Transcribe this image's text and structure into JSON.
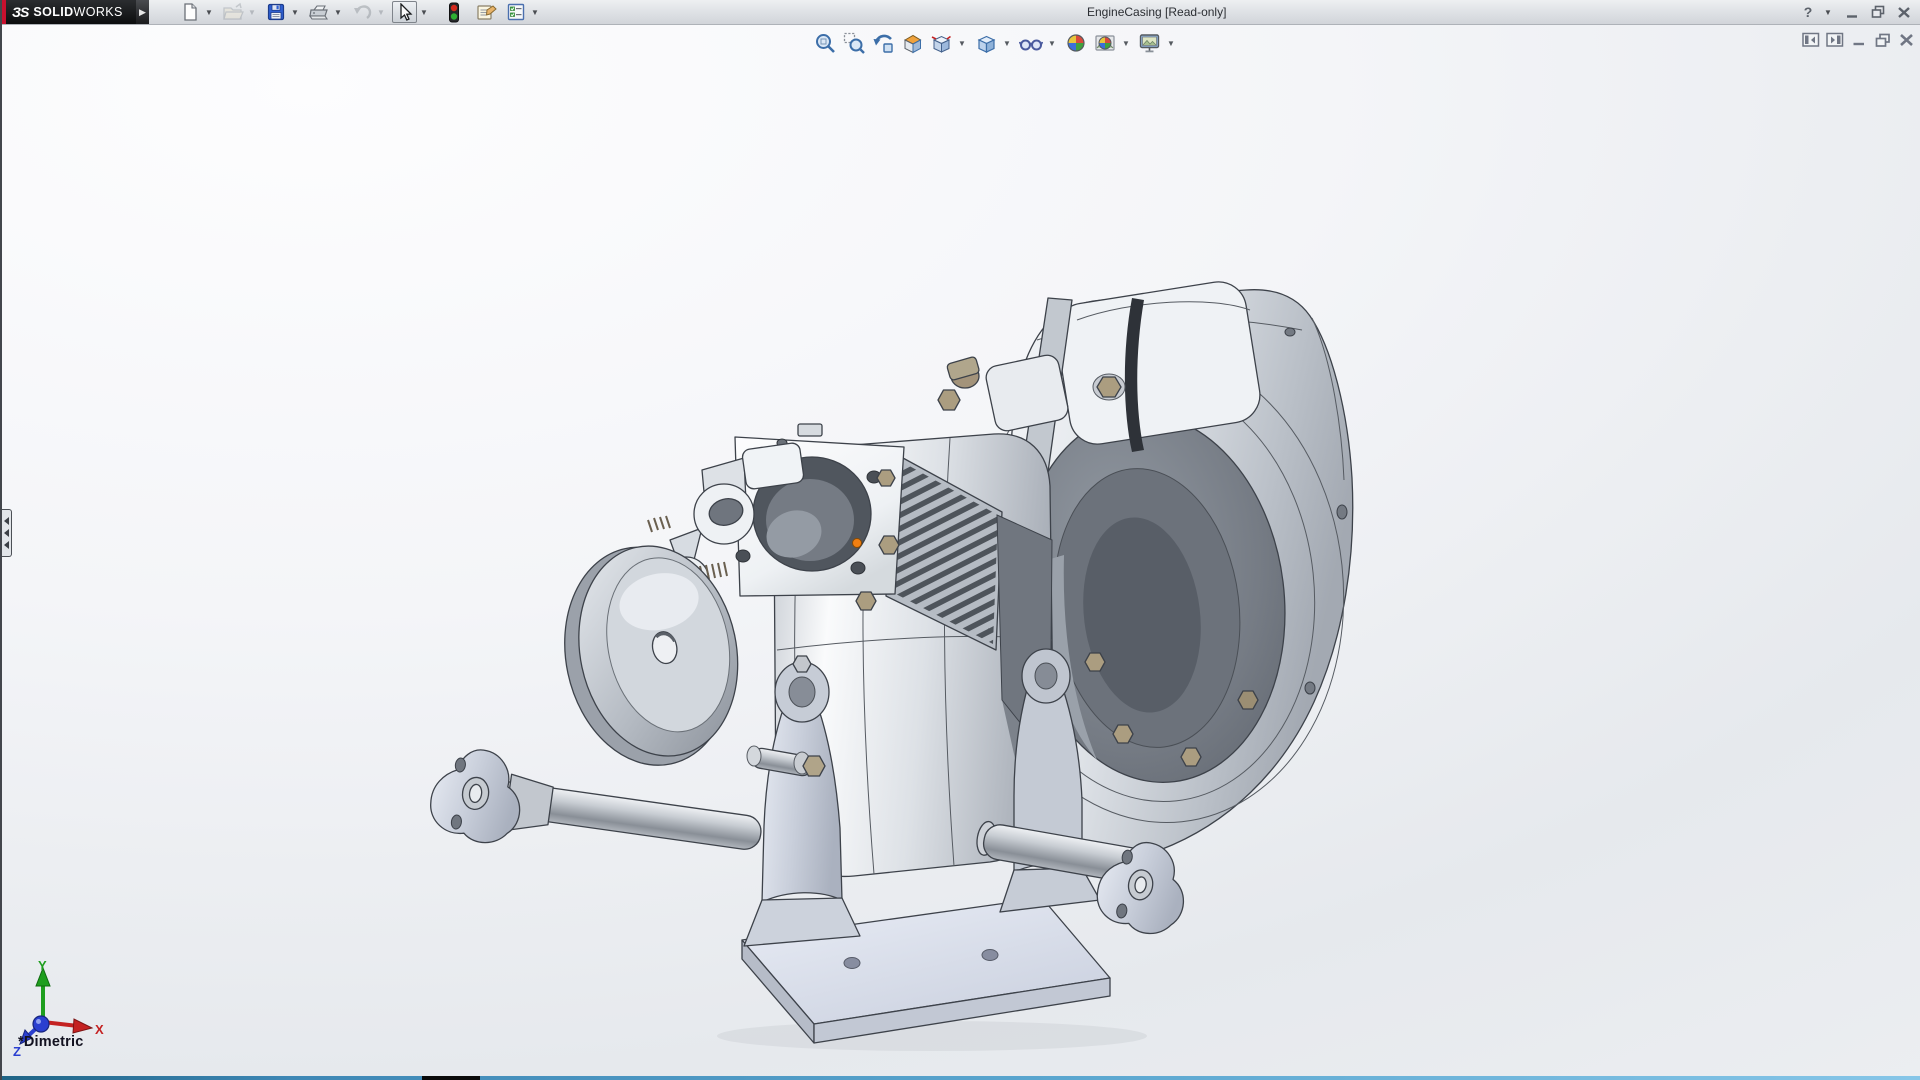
{
  "window": {
    "title": "EngineCasing [Read-only]",
    "logo": {
      "mark": "ЗS",
      "brand_bold": "SOLID",
      "brand_light": "WORKS"
    },
    "controls": {
      "help": "Help",
      "minimize": "Minimize",
      "restore": "Restore Down",
      "close": "Close"
    }
  },
  "toolbar": {
    "items": [
      {
        "name": "new",
        "tooltip": "New",
        "enabled": true,
        "dropdown": true
      },
      {
        "name": "open",
        "tooltip": "Open",
        "enabled": false,
        "dropdown": true
      },
      {
        "name": "save",
        "tooltip": "Save",
        "enabled": true,
        "dropdown": true
      },
      {
        "name": "print",
        "tooltip": "Print",
        "enabled": true,
        "dropdown": true
      },
      {
        "name": "undo",
        "tooltip": "Undo",
        "enabled": false,
        "dropdown": true
      },
      {
        "name": "select",
        "tooltip": "Select",
        "enabled": true,
        "dropdown": true,
        "active": true
      },
      {
        "name": "rebuild",
        "tooltip": "Rebuild",
        "enabled": true,
        "dropdown": false
      },
      {
        "name": "file-properties",
        "tooltip": "File Properties",
        "enabled": true,
        "dropdown": false
      },
      {
        "name": "options",
        "tooltip": "Options",
        "enabled": true,
        "dropdown": true
      }
    ]
  },
  "viewport": {
    "heads_up": [
      {
        "name": "zoom-to-fit",
        "tooltip": "Zoom to Fit",
        "dropdown": false
      },
      {
        "name": "zoom-to-area",
        "tooltip": "Zoom to Area",
        "dropdown": false
      },
      {
        "name": "previous-view",
        "tooltip": "Previous View",
        "dropdown": false
      },
      {
        "name": "section-view",
        "tooltip": "Section View",
        "dropdown": false
      },
      {
        "name": "view-orientation",
        "tooltip": "View Orientation",
        "dropdown": true
      },
      {
        "name": "display-style",
        "tooltip": "Display Style",
        "dropdown": true
      },
      {
        "name": "hide-show-items",
        "tooltip": "Hide/Show Items",
        "dropdown": true
      },
      {
        "name": "edit-appearance",
        "tooltip": "Edit Appearance",
        "dropdown": false
      },
      {
        "name": "apply-scene",
        "tooltip": "Apply Scene",
        "dropdown": true
      },
      {
        "name": "view-settings",
        "tooltip": "View Settings",
        "dropdown": true
      }
    ],
    "doc_controls": [
      {
        "name": "collapse-left-pane",
        "tooltip": "Collapse Left Pane"
      },
      {
        "name": "collapse-right-pane",
        "tooltip": "Collapse Right Pane"
      },
      {
        "name": "minimize-document",
        "tooltip": "Minimize"
      },
      {
        "name": "restore-document",
        "tooltip": "Restore Down"
      },
      {
        "name": "close-document",
        "tooltip": "Close"
      }
    ],
    "view_label": "*Dimetric",
    "triad": {
      "x_label": "X",
      "y_label": "Y",
      "z_label": "Z",
      "x_color": "#c42222",
      "y_color": "#1e9e1e",
      "z_color": "#2a3fd0"
    },
    "selection_color": "#f07f13"
  },
  "colors": {
    "logo_accent": "#c8102e",
    "titlebar_top": "#eef0f2",
    "titlebar_bottom": "#d2d5da",
    "viewport_bottom_border": "#4a93c4",
    "bolt_tan": "#ab9d80"
  }
}
